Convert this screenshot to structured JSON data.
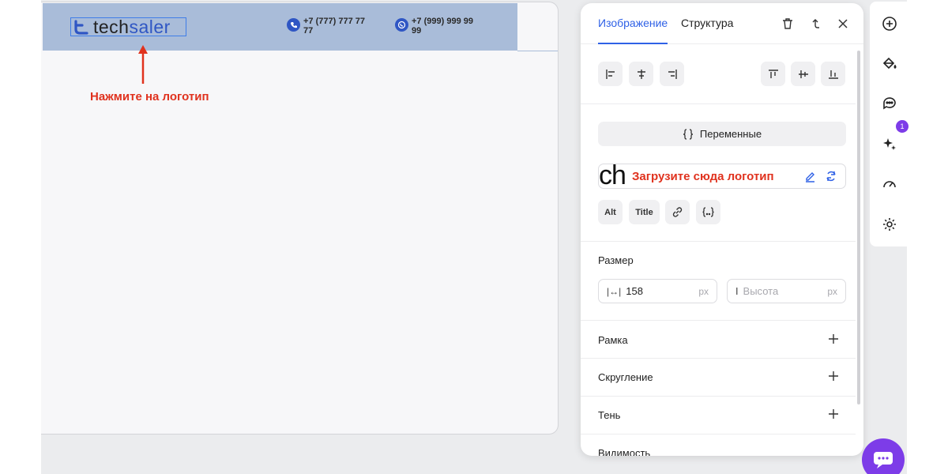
{
  "site": {
    "logo_text_dark": "tech",
    "logo_text_blue": "saler",
    "phones": [
      {
        "number": "+7 (777) 777 77 77",
        "icon": "phone-icon"
      },
      {
        "number": "+7 (999) 999 99 99",
        "icon": "whatsapp-icon"
      }
    ]
  },
  "annotations": {
    "click_logo": "Нажмите на логотип",
    "upload_logo": "Загрузите сюда логотип"
  },
  "panel": {
    "tabs": [
      {
        "label": "Изображение",
        "active": true
      },
      {
        "label": "Структура",
        "active": false
      }
    ],
    "variables_label": "Переменные",
    "image_preview_text": "ch",
    "alt_label": "Alt",
    "title_label": "Title",
    "size_label": "Размер",
    "width_value": "158",
    "width_unit": "px",
    "height_placeholder": "Высота",
    "height_unit": "px",
    "sections": [
      {
        "label": "Рамка"
      },
      {
        "label": "Скругление"
      },
      {
        "label": "Тень"
      },
      {
        "label": "Видимость"
      }
    ]
  },
  "toolbar": {
    "badge_count": "1"
  },
  "colors": {
    "accent": "#2f61e6",
    "annotation": "#e0321e",
    "header_highlight": "#a9bcd9",
    "chat_button": "#7d3ce8"
  }
}
